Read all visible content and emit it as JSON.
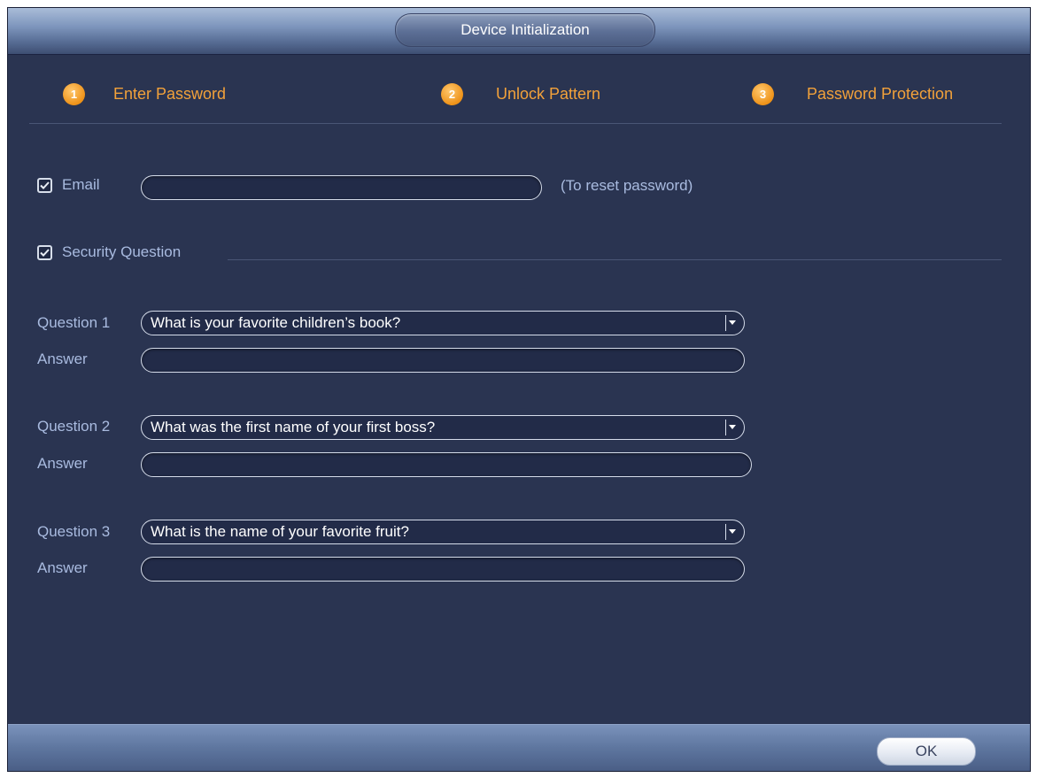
{
  "window": {
    "title": "Device Initialization"
  },
  "steps": [
    {
      "num": "1",
      "label": "Enter Password"
    },
    {
      "num": "2",
      "label": "Unlock Pattern"
    },
    {
      "num": "3",
      "label": "Password Protection"
    }
  ],
  "email": {
    "checked": true,
    "label": "Email",
    "value": "",
    "hint": "(To reset password)"
  },
  "security": {
    "checked": true,
    "label": "Security Question"
  },
  "questions": [
    {
      "label": "Question 1",
      "value": "What is your favorite children’s book?",
      "answer_label": "Answer",
      "answer_value": ""
    },
    {
      "label": "Question 2",
      "value": "What was the first name of your first boss?",
      "answer_label": "Answer",
      "answer_value": ""
    },
    {
      "label": "Question 3",
      "value": "What is the name of your favorite fruit?",
      "answer_label": "Answer",
      "answer_value": ""
    }
  ],
  "footer": {
    "ok_label": "OK"
  },
  "icons": {
    "checkbox": "check-icon",
    "dropdown": "chevron-down-icon"
  },
  "colors": {
    "background": "#2a3451",
    "step_accent": "#f2a13a",
    "label": "#a9bbe0",
    "titlebar": "#7e96bd"
  }
}
